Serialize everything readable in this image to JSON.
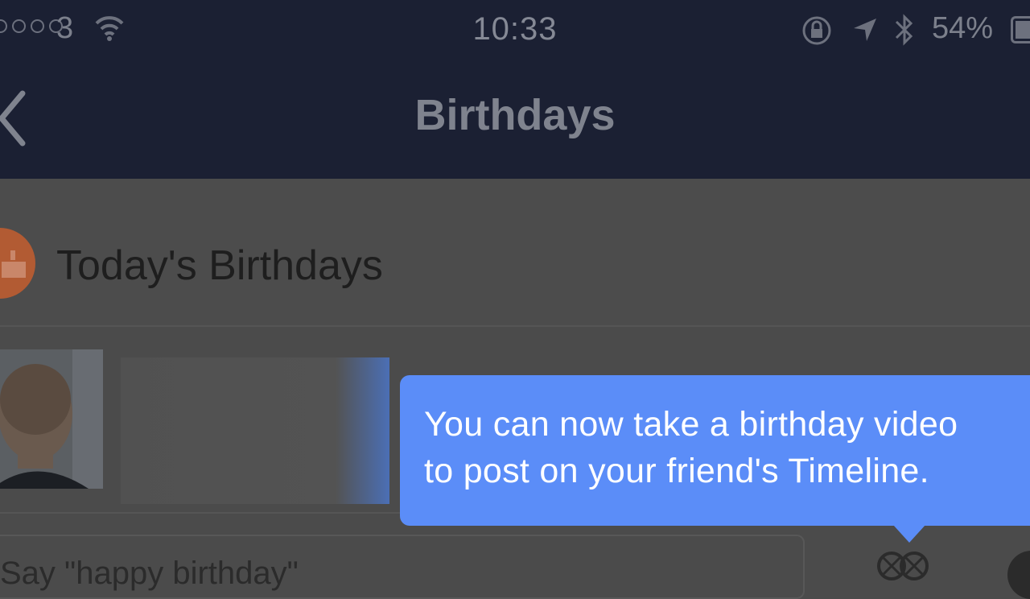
{
  "status_bar": {
    "carrier": "3",
    "time": "10:33",
    "battery_percent": "54%"
  },
  "nav": {
    "title": "Birthdays"
  },
  "section": {
    "title": "Today's Birthdays"
  },
  "tooltip": {
    "line1": "You can now take a birthday video",
    "line2": "to post on your friend's Timeline."
  },
  "message_input": {
    "placeholder": "Say \"happy birthday\""
  },
  "icons": {
    "back": "chevron-left-icon",
    "wifi": "wifi-icon",
    "orientation_lock": "orientation-lock-icon",
    "location": "location-arrow-icon",
    "bluetooth": "bluetooth-icon",
    "battery": "battery-icon",
    "cake": "cake-icon",
    "video": "video-reel-icon"
  },
  "colors": {
    "header_bg": "#1b2033",
    "tooltip_bg": "#5b8df8",
    "cake_accent": "#b25b33"
  }
}
